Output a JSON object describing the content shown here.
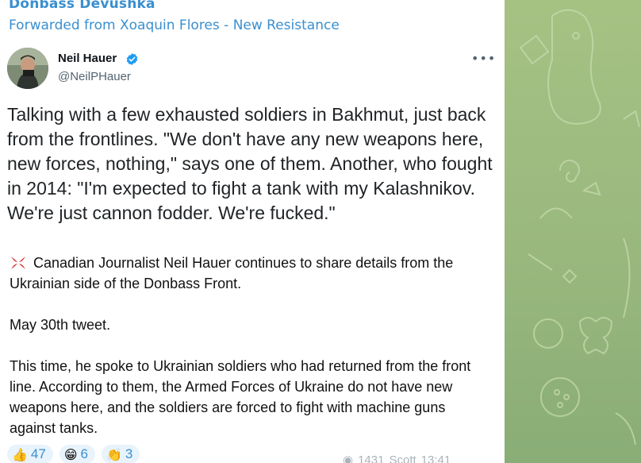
{
  "header": {
    "channel_name": "Donbass Devushka",
    "forwarded_from": "Forwarded from Xoaquin Flores - New Resistance"
  },
  "tweet": {
    "author_name": "Neil Hauer",
    "handle": "@NeilPHauer",
    "more_icon": "more-dots-icon",
    "verified_icon": "verified-badge-icon",
    "text": "Talking with a few exhausted soldiers in Bakhmut, just back from the frontlines. \"We don't have any new weapons here, new forces, nothing,\" says one of them. Another, who fought in 2014: \"I'm expected to fight a tank with my Kalashnikov. We're just cannon fodder. We're fucked.\""
  },
  "body": {
    "paragraphs": [
      "Canadian Journalist Neil Hauer continues to share details from the Ukrainian side of the Donbass Front.",
      "May 30th tweet.",
      "This time, he spoke to Ukrainian soldiers who had returned from the front line. According to them, the Armed Forces of Ukraine do not have new weapons here, and the soldiers are forced to fight with machine guns against tanks."
    ],
    "lead_icon": "anger-symbol-icon"
  },
  "reactions": [
    {
      "emoji": "👍",
      "count": "47",
      "icon": "thumbs-up-icon"
    },
    {
      "emoji": "😁",
      "count": "6",
      "icon": "grinning-face-icon"
    },
    {
      "emoji": "👏",
      "count": "3",
      "icon": "clapping-hands-icon"
    }
  ],
  "meta": {
    "views": "1431",
    "author": "Scott",
    "time": "13:41"
  },
  "colors": {
    "accent": "#3a8fcf",
    "wallpaper": "#a6c283",
    "verified": "#1d9bf0"
  }
}
